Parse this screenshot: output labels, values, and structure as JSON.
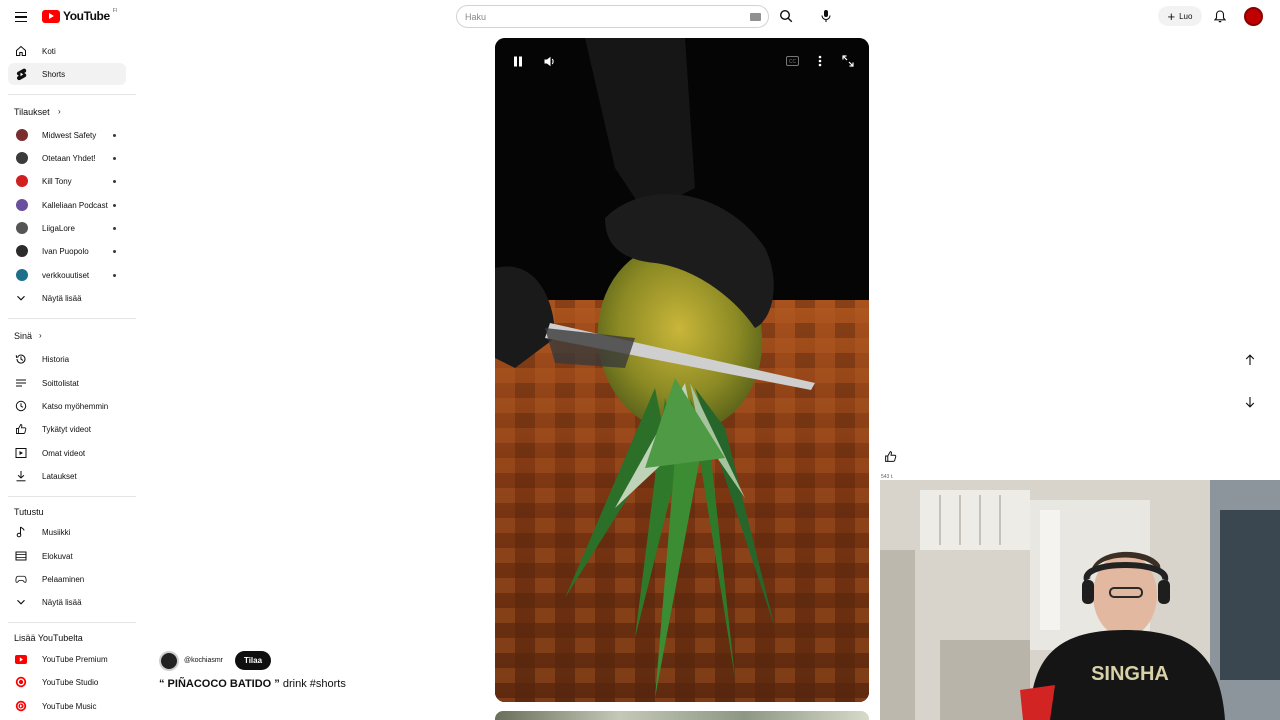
{
  "header": {
    "logo_text": "YouTube",
    "logo_region": "FI",
    "search_placeholder": "Haku",
    "create_label": "Luo"
  },
  "sidebar": {
    "main": [
      {
        "label": "Koti",
        "icon": "home-icon"
      },
      {
        "label": "Shorts",
        "icon": "shorts-icon",
        "active": true
      }
    ],
    "subscriptions_title": "Tilaukset",
    "subscriptions": [
      {
        "label": "Midwest Safety",
        "color": "#7a2e2e"
      },
      {
        "label": "Otetaan Yhdet!",
        "color": "#3b3b3b"
      },
      {
        "label": "Kill Tony",
        "color": "#d11f1f"
      },
      {
        "label": "Kalleliaan Podcast",
        "color": "#6a4fa0"
      },
      {
        "label": "LiigaLore",
        "color": "#555555"
      },
      {
        "label": "Ivan Puopolo",
        "color": "#2b2b2b"
      },
      {
        "label": "verkkouutiset",
        "color": "#1f6f8b"
      }
    ],
    "show_more_1": "Näytä lisää",
    "you_title": "Sinä",
    "you_items": [
      {
        "label": "Historia",
        "icon": "history-icon"
      },
      {
        "label": "Soittolistat",
        "icon": "playlists-icon"
      },
      {
        "label": "Katso myöhemmin",
        "icon": "watch-later-icon"
      },
      {
        "label": "Tykätyt videot",
        "icon": "liked-videos-icon"
      },
      {
        "label": "Omat videot",
        "icon": "your-videos-icon"
      },
      {
        "label": "Lataukset",
        "icon": "downloads-icon"
      }
    ],
    "explore_title": "Tutustu",
    "explore_items": [
      {
        "label": "Musiikki",
        "icon": "music-icon"
      },
      {
        "label": "Elokuvat",
        "icon": "movies-icon"
      },
      {
        "label": "Pelaaminen",
        "icon": "gaming-icon"
      }
    ],
    "show_more_2": "Näytä lisää",
    "more_title": "Lisää YouTubelta",
    "more_items": [
      {
        "label": "YouTube Premium"
      },
      {
        "label": "YouTube Studio"
      },
      {
        "label": "YouTube Music"
      }
    ]
  },
  "short": {
    "channel_handle": "@kochiasmr",
    "subscribe_label": "Tilaa",
    "title_quoted": "“ PIÑACOCO BATIDO ”",
    "title_rest": " drink #shorts",
    "like_count": "543 t."
  },
  "colors": {
    "brand_red": "#ff0000",
    "subscribe_bg": "#0f0f0f",
    "active_bg": "#f2f2f2"
  }
}
